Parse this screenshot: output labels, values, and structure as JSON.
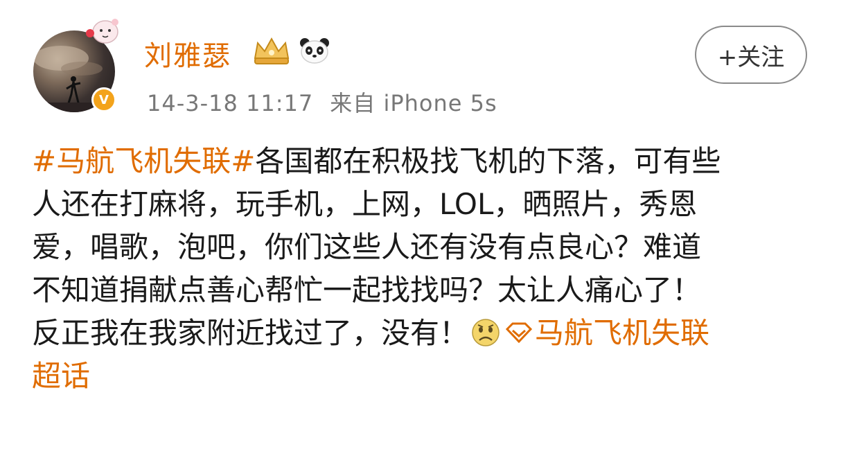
{
  "post": {
    "username": "刘雅瑟",
    "timestamp": "14-3-18 11:17",
    "source": "来自 iPhone 5s",
    "follow_label": "+关注",
    "hashtag": "#马航飞机失联#",
    "text_line1_rest": "各国都在积极找飞机的下落，可有些",
    "text_line2": "人还在打麻将，玩手机，上网，LOL，晒照片，秀恩",
    "text_line3": "爱，唱歌，泡吧，你们这些人还有没有点良心？难道",
    "text_line4": "不知道捐献点善心帮忙一起找找吗？太让人痛心了！",
    "text_line5": "反正我在我家附近找过了，没有！",
    "supertopic_line5": "马航飞机失联",
    "supertopic_line6": "超话"
  },
  "icons": {
    "avatar": "avatar-photo",
    "verified": "verified-v-badge",
    "crown": "crown-icon",
    "panda": "panda-icon",
    "emoji": "sad-face-emoji",
    "supertopic": "supertopic-diamond-icon"
  },
  "colors": {
    "username": "#e06c00",
    "hashtag": "#e06c00",
    "meta": "#777777",
    "verified": "#f3a31b"
  }
}
